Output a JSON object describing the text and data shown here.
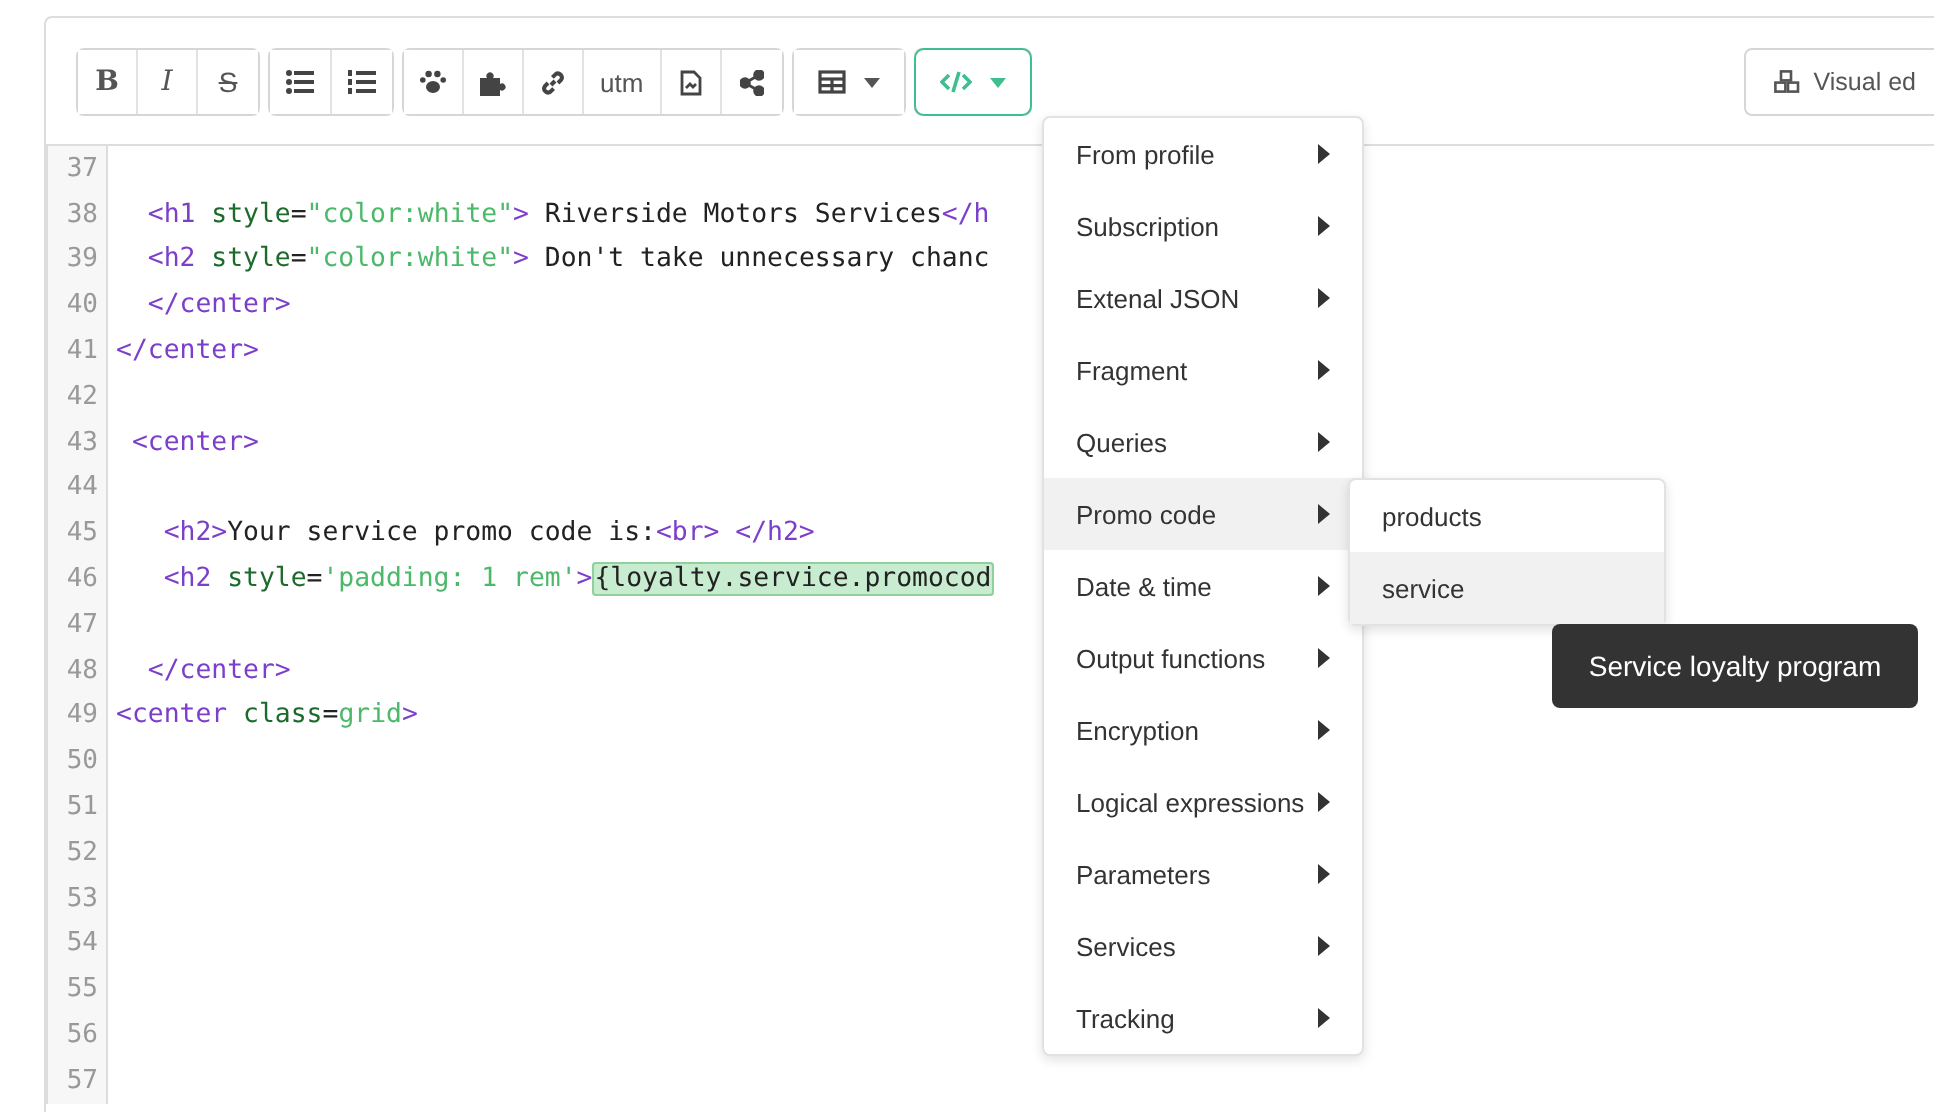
{
  "toolbar": {
    "groups": [
      {
        "buttons": [
          {
            "kind": "bold",
            "label": "B"
          },
          {
            "kind": "italic",
            "label": "I"
          },
          {
            "kind": "strike",
            "label": "S"
          }
        ]
      },
      {
        "buttons": [
          {
            "kind": "bullets"
          },
          {
            "kind": "numbers"
          }
        ]
      },
      {
        "buttons": [
          {
            "kind": "paw"
          },
          {
            "kind": "puzzle"
          },
          {
            "kind": "link"
          },
          {
            "kind": "text",
            "label": "utm"
          },
          {
            "kind": "file"
          },
          {
            "kind": "share"
          }
        ]
      },
      {
        "buttons": [
          {
            "kind": "table",
            "dropdown": true,
            "selected": false
          }
        ]
      },
      {
        "buttons": [
          {
            "kind": "code",
            "dropdown": true,
            "selected": true
          }
        ]
      }
    ],
    "visual_editor": {
      "label": "Visual ed"
    }
  },
  "editor": {
    "lines": [
      {
        "number": "37"
      },
      {
        "number": "38",
        "tokens": [
          {
            "kind": "tag",
            "text": "  <h1 "
          },
          {
            "kind": "attr",
            "text": "style"
          },
          {
            "kind": "text",
            "text": "="
          },
          {
            "kind": "str",
            "text": "\"color:white\""
          },
          {
            "kind": "tag",
            "text": ">"
          },
          {
            "kind": "text",
            "text": " Riverside Motors Services"
          },
          {
            "kind": "tag",
            "text": "</h"
          }
        ]
      },
      {
        "number": "39",
        "tokens": [
          {
            "kind": "tag",
            "text": "  <h2 "
          },
          {
            "kind": "attr",
            "text": "style"
          },
          {
            "kind": "text",
            "text": "="
          },
          {
            "kind": "str",
            "text": "\"color:white\""
          },
          {
            "kind": "tag",
            "text": ">"
          },
          {
            "kind": "text",
            "text": " Don't take unnecessary chanc"
          }
        ]
      },
      {
        "number": "40",
        "tokens": [
          {
            "kind": "tag",
            "text": "  </center>"
          }
        ]
      },
      {
        "number": "41",
        "tokens": [
          {
            "kind": "tag",
            "text": "</center>"
          }
        ]
      },
      {
        "number": "42"
      },
      {
        "number": "43",
        "tokens": [
          {
            "kind": "tag",
            "text": " <center>"
          }
        ]
      },
      {
        "number": "44"
      },
      {
        "number": "45",
        "tokens": [
          {
            "kind": "tag",
            "text": "   <h2>"
          },
          {
            "kind": "text",
            "text": "Your service promo code is:"
          },
          {
            "kind": "tag",
            "text": "<br> </h2>"
          }
        ]
      },
      {
        "number": "46",
        "tokens": [
          {
            "kind": "tag",
            "text": "   <h2 "
          },
          {
            "kind": "attr",
            "text": "style"
          },
          {
            "kind": "text",
            "text": "="
          },
          {
            "kind": "str",
            "text": "'padding: 1 rem'"
          },
          {
            "kind": "tag",
            "text": ">"
          },
          {
            "kind": "highlight",
            "text": "{loyalty.service.promocod"
          }
        ]
      },
      {
        "number": "47"
      },
      {
        "number": "48",
        "tokens": [
          {
            "kind": "tag",
            "text": "  </center>"
          }
        ]
      },
      {
        "number": "49",
        "tokens": [
          {
            "kind": "tag",
            "text": "<center "
          },
          {
            "kind": "attr",
            "text": "class"
          },
          {
            "kind": "text",
            "text": "="
          },
          {
            "kind": "str",
            "text": "grid"
          },
          {
            "kind": "tag",
            "text": ">"
          }
        ]
      },
      {
        "number": "50"
      },
      {
        "number": "51"
      },
      {
        "number": "52"
      },
      {
        "number": "53"
      },
      {
        "number": "54"
      },
      {
        "number": "55"
      },
      {
        "number": "56"
      },
      {
        "number": "57"
      }
    ]
  },
  "menu": {
    "items": [
      {
        "label": "From profile",
        "selected": false
      },
      {
        "label": "Subscription",
        "selected": false
      },
      {
        "label": "Extenal JSON",
        "selected": false
      },
      {
        "label": "Fragment",
        "selected": false
      },
      {
        "label": "Queries",
        "selected": false
      },
      {
        "label": "Promo code",
        "selected": true
      },
      {
        "label": "Date & time",
        "selected": false
      },
      {
        "label": "Output functions",
        "selected": false
      },
      {
        "label": "Encryption",
        "selected": false
      },
      {
        "label": "Logical expressions",
        "selected": false
      },
      {
        "label": "Parameters",
        "selected": false
      },
      {
        "label": "Services",
        "selected": false
      },
      {
        "label": "Tracking",
        "selected": false
      }
    ]
  },
  "submenu": {
    "items": [
      {
        "label": "products",
        "selected": false
      },
      {
        "label": "service",
        "selected": true
      }
    ]
  },
  "tooltip": {
    "text": "Service loyalty program"
  }
}
